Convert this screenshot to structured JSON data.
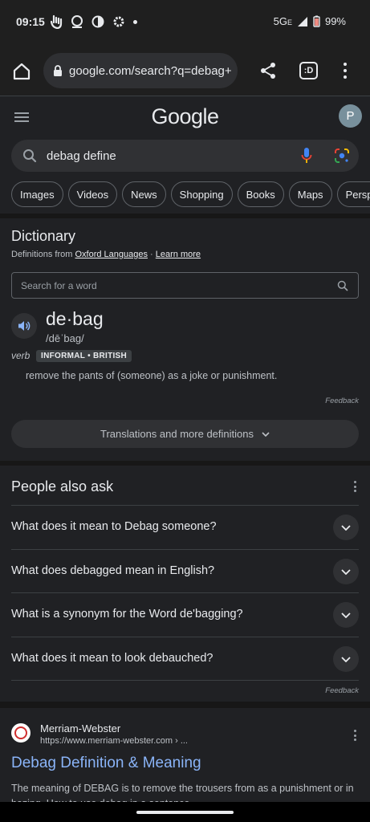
{
  "status_bar": {
    "time": "09:15",
    "network": "5G",
    "network_sub": "E",
    "battery": "99%",
    "icons": [
      "hand-gesture-icon",
      "pulse-icon",
      "contrast-icon",
      "settings-gear-icon",
      "notification-dot-icon"
    ]
  },
  "browser": {
    "url": "google.com/search?q=debag+",
    "tabs_label": ":D"
  },
  "google": {
    "logo": "Google",
    "avatar_initial": "P",
    "query": "debag define",
    "chips": [
      "Images",
      "Videos",
      "News",
      "Shopping",
      "Books",
      "Maps",
      "Perspe"
    ]
  },
  "dictionary": {
    "title": "Dictionary",
    "source_prefix": "Definitions from ",
    "source_link": "Oxford Languages",
    "separator": " · ",
    "learn_more": "Learn more",
    "search_placeholder": "Search for a word",
    "headword": "de·bag",
    "phonetic": "/dēˈbag/",
    "part_of_speech": "verb",
    "register_labels": "INFORMAL • BRITISH",
    "definition": "remove the pants of (someone) as a joke or punishment.",
    "feedback": "Feedback",
    "more_button": "Translations and more definitions"
  },
  "people_also_ask": {
    "title": "People also ask",
    "questions": [
      "What does it mean to Debag someone?",
      "What does debagged mean in English?",
      "What is a synonym for the Word de'bagging?",
      "What does it mean to look debauched?"
    ],
    "feedback": "Feedback"
  },
  "result": {
    "site_name": "Merriam-Webster",
    "site_url": "https://www.merriam-webster.com › ...",
    "title": "Debag Definition & Meaning",
    "snippet": "The meaning of DEBAG is to remove the trousers from as a punishment or in hazing. How to use debag in a sentence."
  },
  "colors": {
    "background": "#202124",
    "link": "#8ab4f8",
    "text": "#e8eaed"
  }
}
